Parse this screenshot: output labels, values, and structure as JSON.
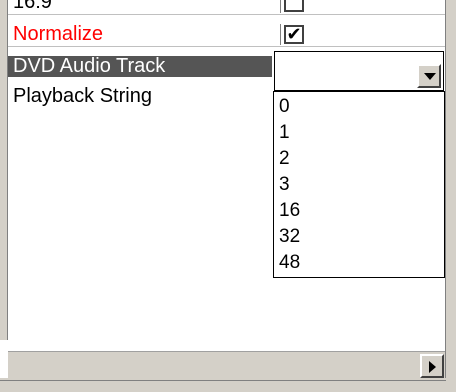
{
  "properties": {
    "rows": [
      {
        "name": "16:9",
        "color": "#000000"
      },
      {
        "name": "Normalize",
        "color": "#ff0000"
      },
      {
        "name": "DVD Audio Track",
        "color": "#ffffff"
      },
      {
        "name": "Playback String",
        "color": "#000000"
      }
    ],
    "normalize_checked": true,
    "ratio_checked": false
  },
  "combo": {
    "selected_value": "",
    "icon": "chevron-down-icon"
  },
  "dropdown": {
    "options": [
      "0",
      "1",
      "2",
      "3",
      "16",
      "32",
      "48"
    ]
  },
  "scrollbar": {
    "right_arrow_icon": "chevron-right-icon"
  },
  "colors": {
    "selection_bg": "#555555",
    "highlight_text": "#ff0000",
    "chrome": "#d4d0c8"
  }
}
